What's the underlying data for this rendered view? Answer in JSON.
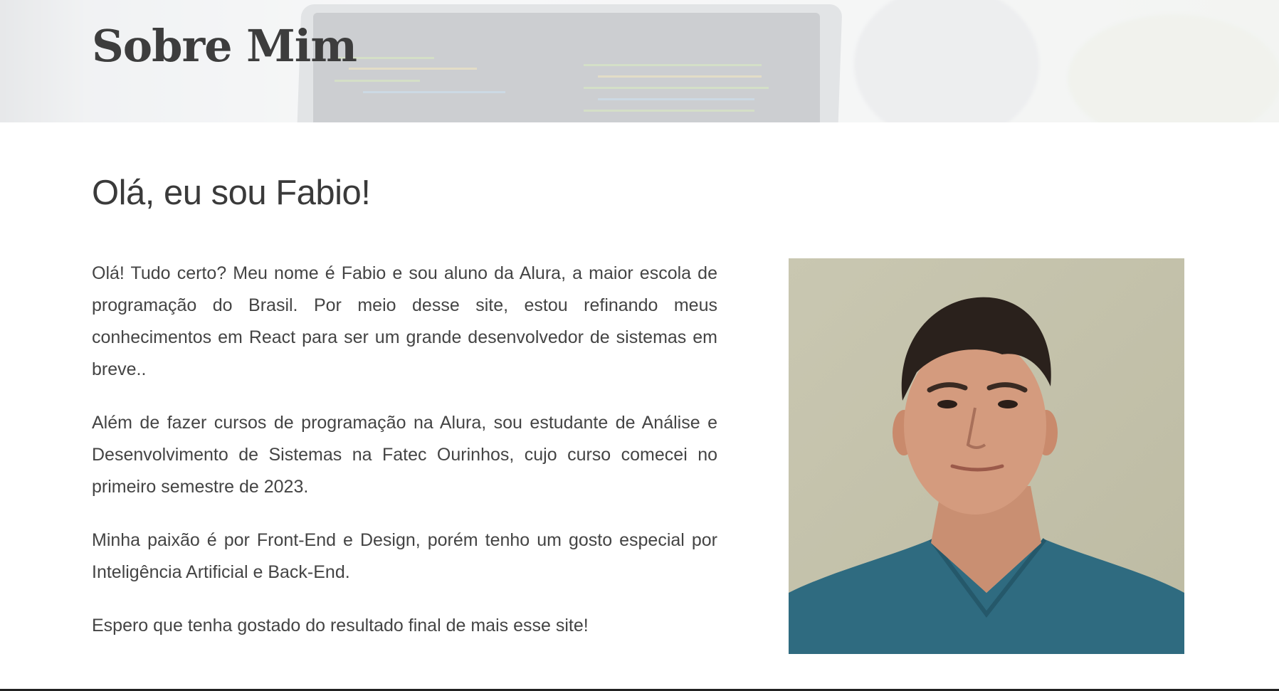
{
  "header": {
    "title": "Sobre Mim"
  },
  "main": {
    "greeting": "Olá, eu sou Fabio!",
    "paragraphs": [
      "Olá! Tudo certo? Meu nome é Fabio e sou aluno da Alura, a maior escola de programação do Brasil. Por meio desse site, estou refinando meus conhecimentos em React para ser um grande desenvolvedor de sistemas em breve..",
      "Além de fazer cursos de programação na Alura, sou estudante de Análise e Desenvolvimento de Sistemas na Fatec Ourinhos, cujo curso comecei no primeiro semestre de 2023.",
      "Minha paixão é por Front-End e Design, porém tenho um gosto especial por Inteligência Artificial e Back-End.",
      "Espero que tenha gostado do resultado final de mais esse site!"
    ]
  },
  "colors": {
    "text": "#3b3b3b",
    "background": "#ffffff",
    "rule": "#222222",
    "shirt": "#2f6b80",
    "wall": "#c7c5ae"
  }
}
